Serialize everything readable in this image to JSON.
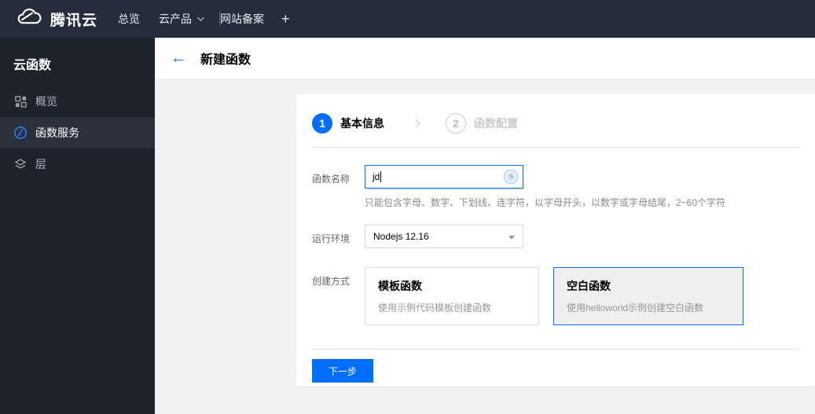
{
  "topnav": {
    "brand": "腾讯云",
    "overview": "总览",
    "products": "云产品",
    "icp": "网站备案",
    "add_tab": "+"
  },
  "sidebar": {
    "title": "云函数",
    "items": [
      {
        "label": "概览",
        "icon": "grid-icon",
        "active": false
      },
      {
        "label": "函数服务",
        "icon": "scf-icon",
        "active": true
      },
      {
        "label": "层",
        "icon": "layers-icon",
        "active": false
      }
    ]
  },
  "header": {
    "back_icon": "←",
    "title": "新建函数"
  },
  "steps": [
    {
      "num": "1",
      "label": "基本信息",
      "state": "active"
    },
    {
      "num": "2",
      "label": "函数配置",
      "state": "inactive"
    }
  ],
  "form": {
    "name_label": "函数名称",
    "name_value": "jd",
    "name_status_icon": "clock-icon",
    "name_hint": "只能包含字母、数字、下划线、连字符，以字母开头，以数字或字母结尾，2~60个字符",
    "runtime_label": "运行环境",
    "runtime_value": "Nodejs 12.16",
    "method_label": "创建方式",
    "methods": [
      {
        "title": "模板函数",
        "desc": "使用示例代码模板创建函数",
        "selected": false
      },
      {
        "title": "空白函数",
        "desc": "使用helloworld示例创建空白函数",
        "selected": true
      }
    ],
    "next_button": "下一步"
  },
  "colors": {
    "accent": "#006eff",
    "topnav_bg": "#252d3c",
    "sidebar_bg": "#1e222b",
    "sidebar_active_bg": "#2b303b",
    "content_bg": "#f2f2f2",
    "selected_card_bg": "#efefef",
    "step_inactive": "#cccccc"
  }
}
